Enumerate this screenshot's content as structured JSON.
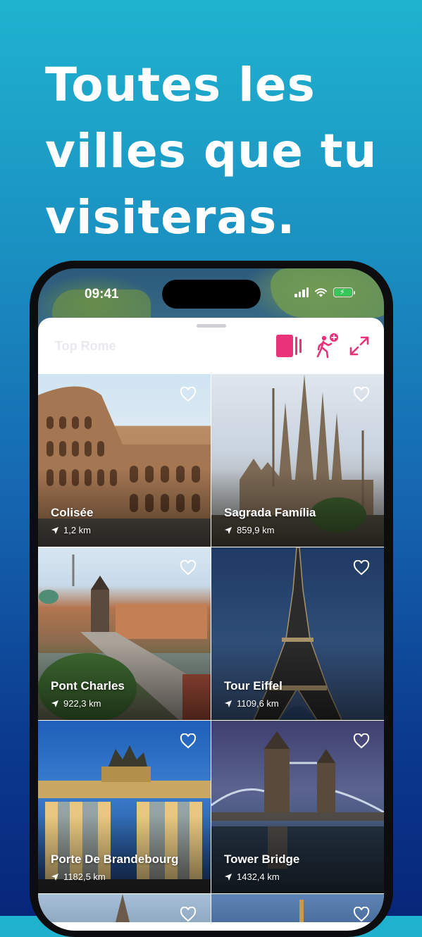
{
  "headline": "Toutes les villes que tu visiteras.",
  "status_bar": {
    "time": "09:41"
  },
  "toolbar": {
    "title": "Top Rome",
    "icons": [
      "cards-view-icon",
      "walking-add-icon",
      "expand-icon"
    ],
    "accent_color": "#e8327a"
  },
  "places": [
    {
      "name": "Colisée",
      "distance": "1,2 km"
    },
    {
      "name": "Sagrada Família",
      "distance": "859,9 km"
    },
    {
      "name": "Pont Charles",
      "distance": "922,3 km"
    },
    {
      "name": "Tour Eiffel",
      "distance": "1109,6 km"
    },
    {
      "name": "Porte De Brandebourg",
      "distance": "1182,5 km"
    },
    {
      "name": "Tower Bridge",
      "distance": "1432,4 km"
    }
  ]
}
